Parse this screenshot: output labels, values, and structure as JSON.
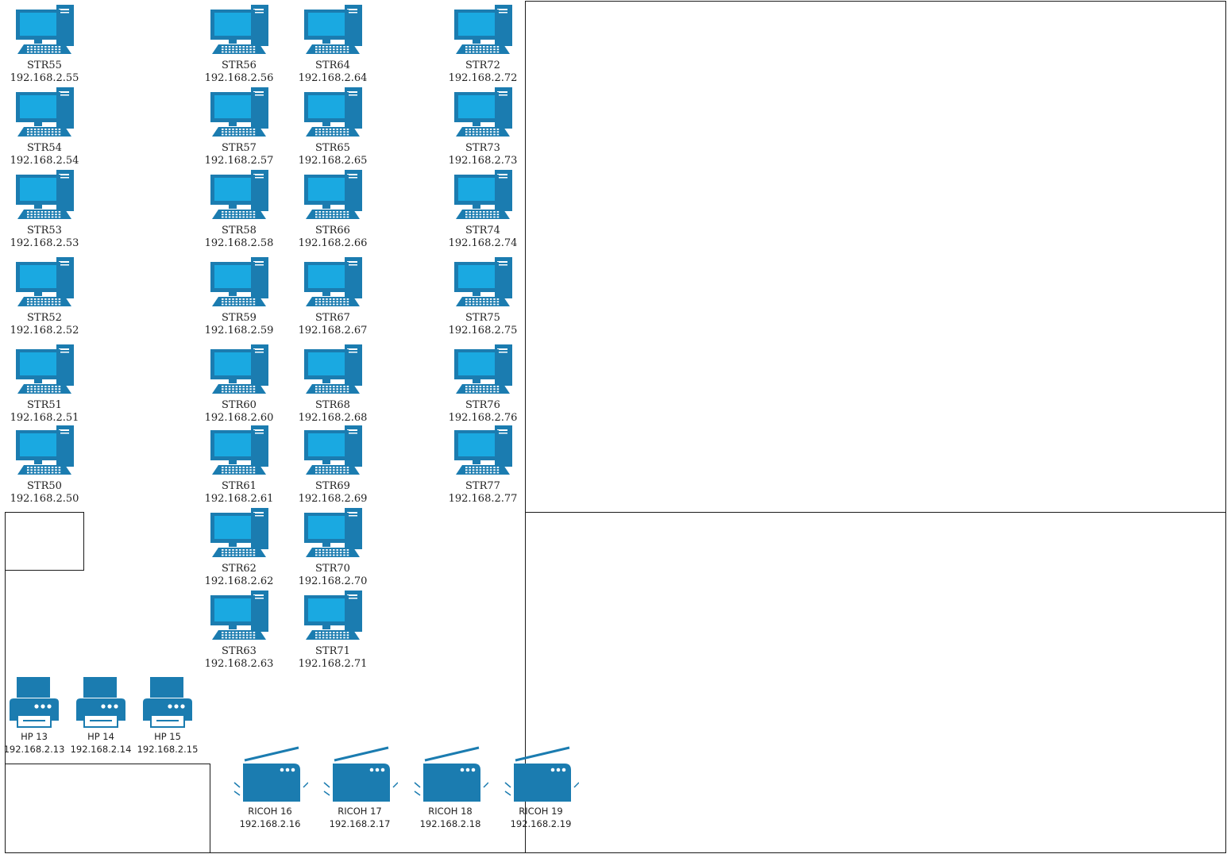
{
  "colors": {
    "device_dark": "#1b7cb0",
    "device_light": "#1aa9e1",
    "border": "#1a1a1a",
    "text": "#222222"
  },
  "computers": [
    {
      "name": "STR55",
      "ip": "192.168.2.55"
    },
    {
      "name": "STR54",
      "ip": "192.168.2.54"
    },
    {
      "name": "STR53",
      "ip": "192.168.2.53"
    },
    {
      "name": "STR52",
      "ip": "192.168.2.52"
    },
    {
      "name": "STR51",
      "ip": "192.168.2.51"
    },
    {
      "name": "STR50",
      "ip": "192.168.2.50"
    },
    {
      "name": "STR56",
      "ip": "192.168.2.56"
    },
    {
      "name": "STR57",
      "ip": "192.168.2.57"
    },
    {
      "name": "STR58",
      "ip": "192.168.2.58"
    },
    {
      "name": "STR59",
      "ip": "192.168.2.59"
    },
    {
      "name": "STR60",
      "ip": "192.168.2.60"
    },
    {
      "name": "STR61",
      "ip": "192.168.2.61"
    },
    {
      "name": "STR62",
      "ip": "192.168.2.62"
    },
    {
      "name": "STR63",
      "ip": "192.168.2.63"
    },
    {
      "name": "STR64",
      "ip": "192.168.2.64"
    },
    {
      "name": "STR65",
      "ip": "192.168.2.65"
    },
    {
      "name": "STR66",
      "ip": "192.168.2.66"
    },
    {
      "name": "STR67",
      "ip": "192.168.2.67"
    },
    {
      "name": "STR68",
      "ip": "192.168.2.68"
    },
    {
      "name": "STR69",
      "ip": "192.168.2.69"
    },
    {
      "name": "STR70",
      "ip": "192.168.2.70"
    },
    {
      "name": "STR71",
      "ip": "192.168.2.71"
    },
    {
      "name": "STR72",
      "ip": "192.168.2.72"
    },
    {
      "name": "STR73",
      "ip": "192.168.2.73"
    },
    {
      "name": "STR74",
      "ip": "192.168.2.74"
    },
    {
      "name": "STR75",
      "ip": "192.168.2.75"
    },
    {
      "name": "STR76",
      "ip": "192.168.2.76"
    },
    {
      "name": "STR77",
      "ip": "192.168.2.77"
    }
  ],
  "printers": [
    {
      "name": "HP 13",
      "ip": "192.168.2.13"
    },
    {
      "name": "HP 14",
      "ip": "192.168.2.14"
    },
    {
      "name": "HP 15",
      "ip": "192.168.2.15"
    }
  ],
  "scanners": [
    {
      "name": "RICOH 16",
      "ip": "192.168.2.16"
    },
    {
      "name": "RICOH 17",
      "ip": "192.168.2.17"
    },
    {
      "name": "RICOH 18",
      "ip": "192.168.2.18"
    },
    {
      "name": "RICOH 19",
      "ip": "192.168.2.19"
    }
  ]
}
